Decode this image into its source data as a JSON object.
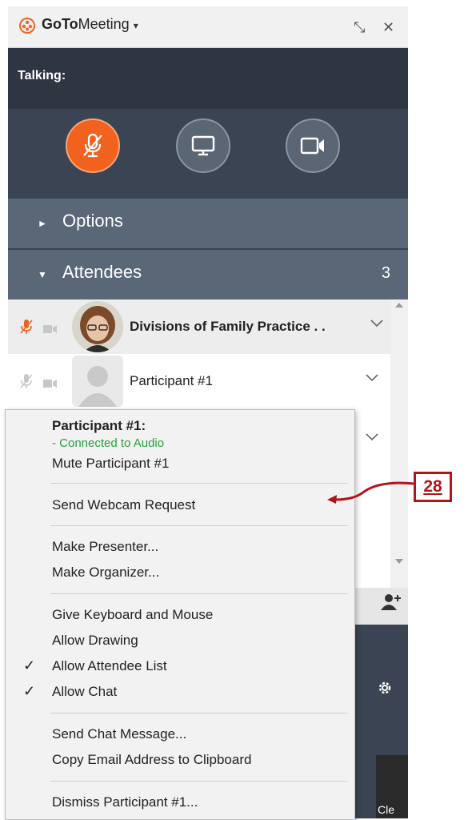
{
  "app": {
    "title_bold": "GoTo",
    "title_regular": "Meeting",
    "caret": "▾"
  },
  "window": {
    "restore": "⤡",
    "close": "✕"
  },
  "talking": {
    "label": "Talking:"
  },
  "sections": {
    "options": "Options",
    "attendees": "Attendees",
    "attendees_count": "3"
  },
  "attendees": [
    {
      "name": "Divisions of Family Practice . ."
    },
    {
      "name": "Participant #1"
    }
  ],
  "context_menu": {
    "header": "Participant #1:",
    "status": "- Connected to Audio",
    "items": [
      "Mute Participant #1",
      "Send Webcam Request",
      "Make Presenter...",
      "Make Organizer...",
      "Give Keyboard and Mouse",
      "Allow Drawing",
      "Allow Attendee List",
      "Allow Chat",
      "Send Chat Message...",
      "Copy Email Address to Clipboard",
      "Dismiss Participant #1..."
    ],
    "checks": [
      "✓",
      "✓"
    ]
  },
  "bottom": {
    "thumbnail_text": "Cle"
  },
  "callout": {
    "number": "28"
  },
  "colors": {
    "accent": "#f2621f",
    "panel": "#3a4452",
    "section": "#5a6777",
    "callout": "#b3141a",
    "connected": "#22a33a"
  },
  "icons": [
    "gotomeeting-logo-icon",
    "restore-icon",
    "close-icon",
    "mic-muted-icon",
    "screen-share-icon",
    "webcam-icon",
    "chevron-down-icon",
    "add-user-icon",
    "gear-icon"
  ]
}
